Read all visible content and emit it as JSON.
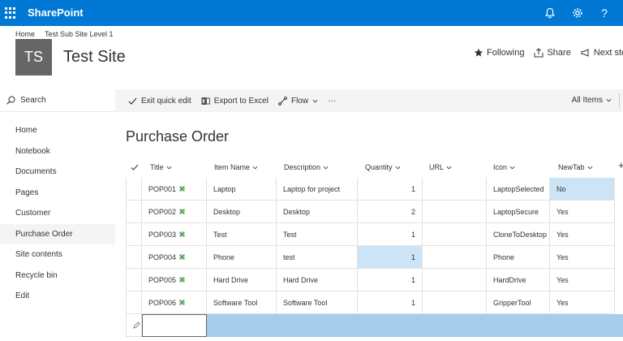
{
  "suitebar": {
    "brand": "SharePoint",
    "icons": [
      "waffle-icon",
      "bell-icon",
      "gear-icon",
      "help-icon"
    ],
    "help_glyph": "?",
    "accent": "#0078d4"
  },
  "site": {
    "breadcrumb": [
      "Home",
      "Test Sub Site Level 1"
    ],
    "logo_text": "TS",
    "title": "Test Site",
    "actions": {
      "following": "Following",
      "share": "Share",
      "next_steps": "Next steps"
    }
  },
  "nav": {
    "search_label": "Search",
    "items": [
      "Home",
      "Notebook",
      "Documents",
      "Pages",
      "Customer",
      "Purchase Order",
      "Site contents",
      "Recycle bin",
      "Edit"
    ],
    "selected": "Purchase Order"
  },
  "commandbar": {
    "exit_quick_edit": "Exit quick edit",
    "export_to_excel": "Export to Excel",
    "flow": "Flow",
    "more": "···",
    "view": "All Items"
  },
  "list": {
    "title": "Purchase Order",
    "add_column": "+",
    "columns": [
      "Title",
      "Item Name",
      "Description",
      "Quantity",
      "URL",
      "Icon",
      "NewTab"
    ],
    "rows": [
      {
        "title": "POP001",
        "item_name": "Laptop",
        "description": "Laptop for project",
        "quantity": "1",
        "url": "",
        "icon": "LaptopSelected",
        "newtab": "No"
      },
      {
        "title": "POP002",
        "item_name": "Desktop",
        "description": "Desktop",
        "quantity": "2",
        "url": "",
        "icon": "LaptopSecure",
        "newtab": "Yes"
      },
      {
        "title": "POP003",
        "item_name": "Test",
        "description": "Test",
        "quantity": "1",
        "url": "",
        "icon": "CloneToDesktop",
        "newtab": "Yes"
      },
      {
        "title": "POP004",
        "item_name": "Phone",
        "description": "test",
        "quantity": "1",
        "url": "",
        "icon": "Phone",
        "newtab": "Yes"
      },
      {
        "title": "POP005",
        "item_name": "Hard Drive",
        "description": "Hard Drive",
        "quantity": "1",
        "url": "",
        "icon": "HardDrive",
        "newtab": "Yes"
      },
      {
        "title": "POP006",
        "item_name": "Software Tool",
        "description": "Software Tool",
        "quantity": "1",
        "url": "",
        "icon": "GripperTool",
        "newtab": "Yes"
      }
    ],
    "selected_cells": [
      "rows.0.newtab",
      "rows.3.quantity"
    ],
    "selection_color": "#cce4f6",
    "new_row_color": "#a7ccec"
  }
}
